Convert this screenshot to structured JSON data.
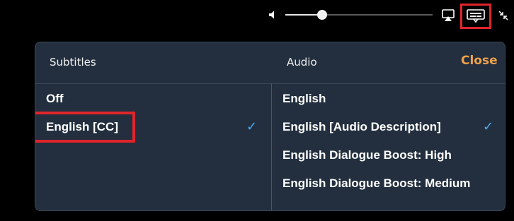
{
  "player": {
    "volume_level": 0.25,
    "icons": {
      "volume": "speaker-icon",
      "airplay": "airplay-icon",
      "subtitles": "subtitles-icon",
      "collapse": "collapse-icon"
    }
  },
  "panel": {
    "subtitles_header": "Subtitles",
    "audio_header": "Audio",
    "close_label": "Close",
    "subtitles_options": [
      "Off",
      "English [CC]"
    ],
    "subtitles_selected": "English [CC]",
    "audio_options": [
      "English",
      "English [Audio Description]",
      "English Dialogue Boost: High",
      "English Dialogue Boost: Medium"
    ],
    "audio_selected": "English [Audio Description]",
    "check_glyph": "✓"
  },
  "colors": {
    "panel_bg": "#232f3e",
    "close_accent": "#f0a24a",
    "check_blue": "#4aa8f0",
    "highlight_red": "#e0242b"
  }
}
